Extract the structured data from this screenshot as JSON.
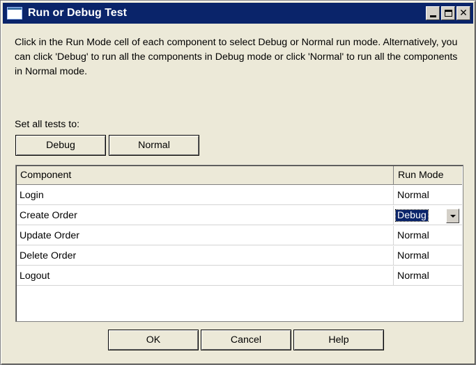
{
  "window": {
    "title": "Run or Debug Test"
  },
  "instructions": "Click in the Run Mode cell of each component to select Debug or Normal run mode. Alternatively, you can click 'Debug' to run all the components in Debug mode or click 'Normal' to run all the components in Normal mode.",
  "set_all": {
    "label": "Set all tests to:",
    "debug_label": "Debug",
    "normal_label": "Normal"
  },
  "table": {
    "columns": [
      "Component",
      "Run Mode"
    ],
    "rows": [
      {
        "component": "Login",
        "mode": "Normal"
      },
      {
        "component": "Create Order",
        "mode": "Debug"
      },
      {
        "component": "Update Order",
        "mode": "Normal"
      },
      {
        "component": "Delete Order",
        "mode": "Normal"
      },
      {
        "component": "Logout",
        "mode": "Normal"
      }
    ]
  },
  "footer": {
    "ok_label": "OK",
    "cancel_label": "Cancel",
    "help_label": "Help"
  }
}
